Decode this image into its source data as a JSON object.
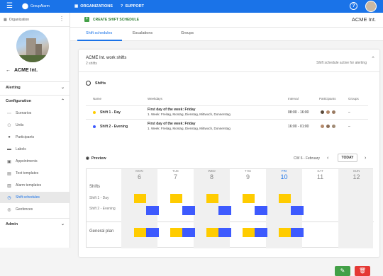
{
  "topbar": {
    "logo_text": "GroupAlarm",
    "nav_organizations": "ORGANIZATIONS",
    "nav_support": "SUPPORT"
  },
  "sidebar": {
    "org_label": "Organization",
    "org_title": "ACME Int.",
    "section_alerting": "Alerting",
    "section_configuration": "Configuration",
    "items": [
      "Scenarios",
      "Units",
      "Participants",
      "Labels",
      "Appointments",
      "Text templates",
      "Alarm templates",
      "Shift schedules",
      "Geofences"
    ],
    "section_admin": "Admin"
  },
  "toolbar": {
    "create_label": "CREATE SHIFT SCHEDULE",
    "org_name": "ACME Int."
  },
  "tabs": [
    "Shift schedules",
    "Escalations",
    "Groups"
  ],
  "schedule": {
    "title": "ACME Int. work shifts",
    "subtitle": "2 shifts",
    "status": "Shift schedule active for alerting",
    "shifts_heading": "Shifts",
    "columns": {
      "name": "Name",
      "weekdays": "Weekdays",
      "interval": "Interval",
      "participants": "Participants",
      "groups": "Groups"
    },
    "rows": [
      {
        "name": "Shift 1 - Day",
        "color": "#ffcc00",
        "weekday_title": "First day of the week: Friday",
        "weekday_detail": "1. Week: Freitag, Montag, Dienstag, Mittwoch, Donnerstag",
        "interval": "08:00 - 16:00",
        "groups": "–"
      },
      {
        "name": "Shift 2 - Evening",
        "color": "#3d5afe",
        "weekday_title": "First day of the week: Friday",
        "weekday_detail": "1. Week: Freitag, Montag, Dienstag, Mittwoch, Donnerstag",
        "interval": "16:00 - 01:00",
        "groups": "–"
      }
    ]
  },
  "preview": {
    "heading": "Preview",
    "cw": "CW 6 - February",
    "today": "TODAY",
    "row_shifts": "Shifts",
    "row_s1": "Shift 1 - Day",
    "row_s2": "Shift 2 - Evening",
    "row_general": "General plan",
    "days": [
      {
        "d": "MON",
        "n": "6"
      },
      {
        "d": "TUE",
        "n": "7"
      },
      {
        "d": "WED",
        "n": "8"
      },
      {
        "d": "THU",
        "n": "9"
      },
      {
        "d": "FRI",
        "n": "10"
      },
      {
        "d": "SAT",
        "n": "11"
      },
      {
        "d": "SUN",
        "n": "12"
      }
    ]
  },
  "colors": {
    "accent": "#1a73e8",
    "shift_day": "#ffcc00",
    "shift_evening": "#3d5afe",
    "edit": "#43a047",
    "delete": "#e53935"
  }
}
